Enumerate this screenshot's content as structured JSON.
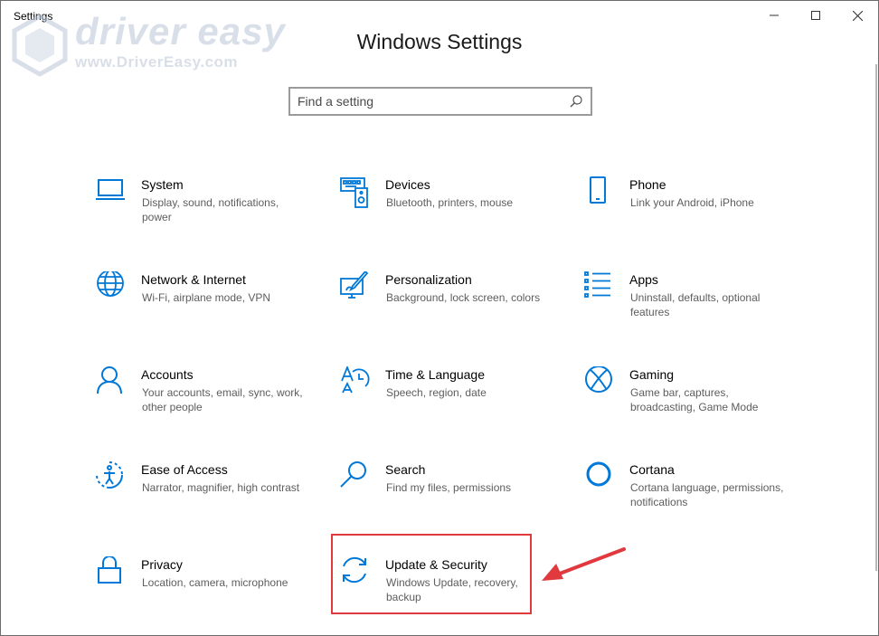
{
  "window": {
    "title": "Settings"
  },
  "watermark": {
    "brand": "driver easy",
    "url": "www.DriverEasy.com"
  },
  "page": {
    "title": "Windows Settings"
  },
  "search": {
    "placeholder": "Find a setting"
  },
  "colors": {
    "accent": "#0078d7",
    "highlight": "#e0393e",
    "description": "#5d5d5d"
  },
  "tiles": [
    {
      "name": "System",
      "desc": "Display, sound, notifications, power",
      "icon": "laptop-icon"
    },
    {
      "name": "Devices",
      "desc": "Bluetooth, printers, mouse",
      "icon": "devices-icon"
    },
    {
      "name": "Phone",
      "desc": "Link your Android, iPhone",
      "icon": "phone-icon"
    },
    {
      "name": "Network & Internet",
      "desc": "Wi-Fi, airplane mode, VPN",
      "icon": "globe-icon"
    },
    {
      "name": "Personalization",
      "desc": "Background, lock screen, colors",
      "icon": "paintbrush-icon"
    },
    {
      "name": "Apps",
      "desc": "Uninstall, defaults, optional features",
      "icon": "apps-list-icon"
    },
    {
      "name": "Accounts",
      "desc": "Your accounts, email, sync, work, other people",
      "icon": "person-icon"
    },
    {
      "name": "Time & Language",
      "desc": "Speech, region, date",
      "icon": "time-language-icon"
    },
    {
      "name": "Gaming",
      "desc": "Game bar, captures, broadcasting, Game Mode",
      "icon": "xbox-icon"
    },
    {
      "name": "Ease of Access",
      "desc": "Narrator, magnifier, high contrast",
      "icon": "ease-of-access-icon"
    },
    {
      "name": "Search",
      "desc": "Find my files, permissions",
      "icon": "magnifier-icon"
    },
    {
      "name": "Cortana",
      "desc": "Cortana language, permissions, notifications",
      "icon": "cortana-icon"
    },
    {
      "name": "Privacy",
      "desc": "Location, camera, microphone",
      "icon": "lock-icon"
    },
    {
      "name": "Update & Security",
      "desc": "Windows Update, recovery, backup",
      "icon": "sync-icon"
    }
  ]
}
